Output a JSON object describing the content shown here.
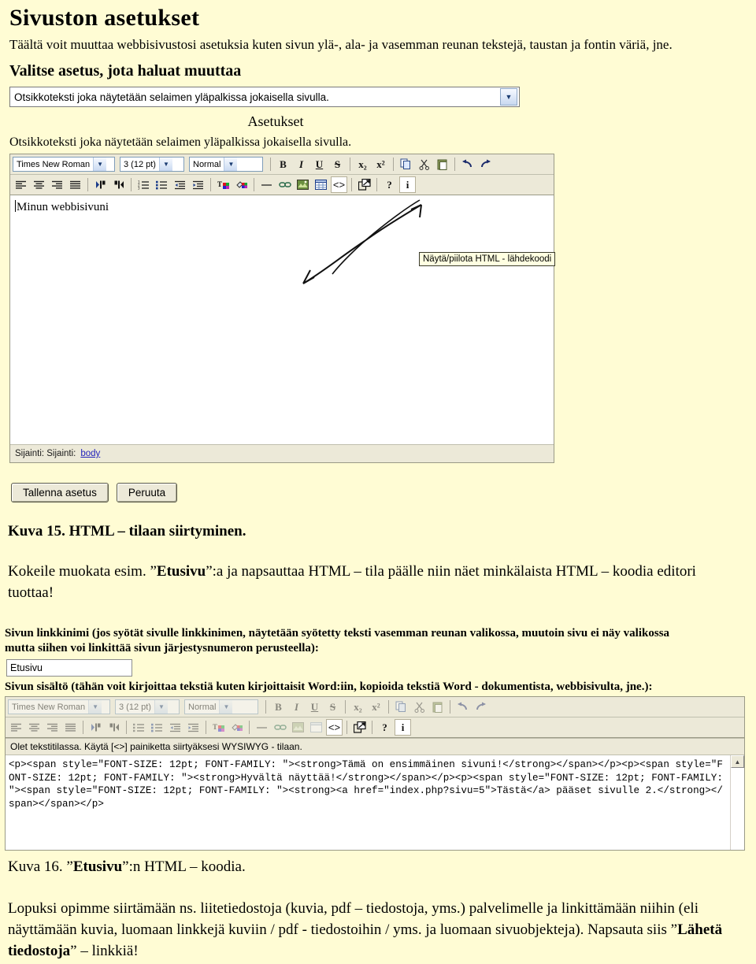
{
  "figure1": {
    "title": "Sivuston asetukset",
    "intro": "Täältä voit muuttaa webbisivustosi asetuksia kuten sivun ylä-, ala- ja vasemman reunan tekstejä, taustan ja fontin väriä, jne.",
    "choose_heading": "Valitse asetus, jota haluat muuttaa",
    "select_value": "Otsikkoteksti joka näytetään selaimen yläpalkissa jokaisella sivulla.",
    "settings_heading": "Asetukset",
    "settings_desc": "Otsikkoteksti joka näytetään selaimen yläpalkissa jokaisella sivulla.",
    "toolbar": {
      "font_family": "Times New Roman",
      "font_size": "3 (12 pt)",
      "paragraph_style": "Normal",
      "bold": "B",
      "italic": "I",
      "underline": "U",
      "strike": "S",
      "subscript": "x₂",
      "superscript": "x²",
      "copy": "copy-icon",
      "cut": "cut-icon",
      "paste": "paste-icon",
      "undo": "undo-icon",
      "redo": "redo-icon",
      "align_left": "align-left-icon",
      "align_center": "align-center-icon",
      "align_right": "align-right-icon",
      "align_justify": "align-justify-icon",
      "ltr": "direction-ltr-icon",
      "rtl": "direction-rtl-icon",
      "ordered_list": "ordered-list-icon",
      "unordered_list": "unordered-list-icon",
      "outdent": "outdent-icon",
      "indent": "indent-icon",
      "text_color": "text-color-icon",
      "bg_color": "background-color-icon",
      "horizontal_rule": "horizontal-rule-icon",
      "link": "link-icon",
      "image": "image-icon",
      "table": "table-icon",
      "html_source": "<>",
      "popup": "popup-editor-icon",
      "help": "?",
      "info": "i"
    },
    "editor_text": "Minun webbisivuni",
    "tooltip": "Näytä/piilota HTML - lähdekoodi",
    "status_label": "Sijainti: Sijainti:",
    "status_path": "body",
    "save_button": "Tallenna asetus",
    "cancel_button": "Peruuta"
  },
  "caption1": {
    "prefix": "Kuva 15. HTML – tilaan siirtyminen."
  },
  "body1": {
    "part1": "Kokeile muokata esim. ”",
    "bold1": "Etusivu",
    "part2": "”:a ja napsauttaa HTML – tila päälle niin näet minkälaista HTML – koodia editori tuottaa!"
  },
  "figure2": {
    "linkname_label_line1": "Sivun linkkinimi (jos syötät sivulle linkkinimen, näytetään syötetty teksti vasemman reunan valikossa, muutoin sivu ei näy valikossa",
    "linkname_label_line2": "mutta siihen voi linkittää sivun järjestysnumeron perusteella):",
    "linkname_value": "Etusivu",
    "content_label": "Sivun sisältö (tähän voit kirjoittaa tekstiä kuten kirjoittaisit Word:iin, kopioida tekstiä Word - dokumentista, webbisivulta, jne.):",
    "toolbar": {
      "font_family": "Times New Roman",
      "font_size": "3 (12 pt)",
      "paragraph_style": "Normal",
      "bold": "B",
      "italic": "I",
      "underline": "U",
      "strike": "S",
      "subscript": "x₂",
      "superscript": "x²",
      "copy": "copy-icon",
      "cut": "cut-icon",
      "paste": "paste-icon",
      "undo": "undo-icon",
      "redo": "redo-icon",
      "align_left": "align-left-icon",
      "align_center": "align-center-icon",
      "align_right": "align-right-icon",
      "align_justify": "align-justify-icon",
      "ltr": "direction-ltr-icon",
      "rtl": "direction-rtl-icon",
      "ordered_list": "ordered-list-icon",
      "unordered_list": "unordered-list-icon",
      "outdent": "outdent-icon",
      "indent": "indent-icon",
      "text_color": "text-color-icon",
      "bg_color": "background-color-icon",
      "horizontal_rule": "horizontal-rule-icon",
      "link": "link-icon",
      "image": "image-icon",
      "table": "table-icon",
      "html_source": "<>",
      "popup": "popup-editor-icon",
      "help": "?",
      "info": "i"
    },
    "status": "Olet tekstitilassa. Käytä [<>] painiketta siirtyäksesi WYSIWYG - tilaan.",
    "source_code": "<p><span style=\"FONT-SIZE: 12pt; FONT-FAMILY: \"><strong>Tämä on ensimmäinen sivuni!</strong></span></p><p><span style=\"FONT-SIZE: 12pt; FONT-FAMILY: \"><strong>Hyvältä näyttää!</strong></span></p><p><span style=\"FONT-SIZE: 12pt; FONT-FAMILY: \"><span style=\"FONT-SIZE: 12pt; FONT-FAMILY: \"><strong><a href=\"index.php?sivu=5\">Tästä</a> pääset sivulle 2.</strong></span></span></p>",
    "scroll_up": "scroll-up-icon"
  },
  "caption2": {
    "prefix": "Kuva 16. ”",
    "bold": "Etusivu",
    "suffix": "”:n HTML – koodia."
  },
  "body2": {
    "part1": "Lopuksi opimme siirtämään ns. liitetiedostoja (kuvia, pdf – tiedostoja, yms.) palvelimelle ja linkittämään niihin (eli näyttämään kuvia, luomaan linkkejä kuviin / pdf - tiedostoihin / yms. ja luomaan sivuobjekteja). Napsauta siis ”",
    "bold1": "Lähetä tiedostoja",
    "part2": "” – linkkiä!"
  },
  "colors": {
    "page_background": "#fffcd4",
    "toolbar_background": "#ece9d8",
    "editor_background": "#ffffff",
    "link": "#2222bb",
    "tooltip_background": "#ffffe1"
  }
}
